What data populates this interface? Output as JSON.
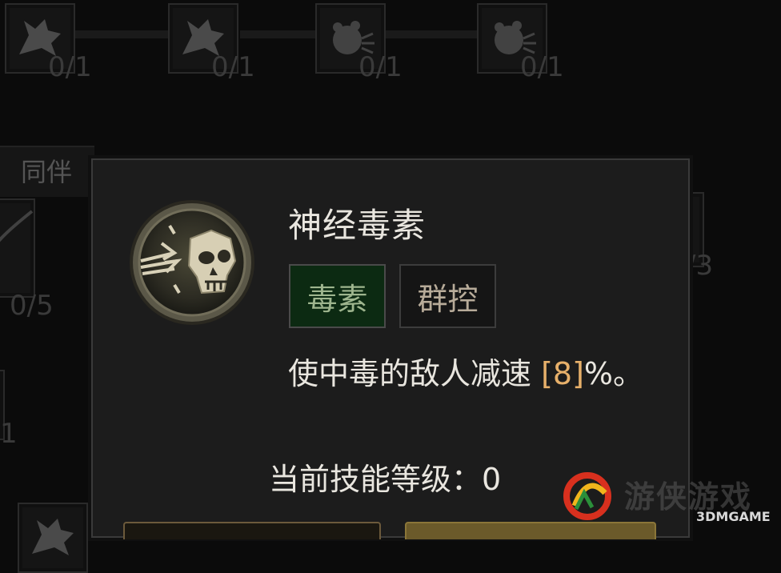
{
  "background": {
    "companion_tab": "同伴",
    "node_counts": [
      "0/1",
      "0/1",
      "0/1",
      "0/1",
      "0/5",
      "/3",
      "1"
    ],
    "node_icons": [
      "wolf-head-icon",
      "wolf-head-icon",
      "bear-roar-icon",
      "bear-roar-icon",
      "thorn-vine-icon",
      "partial-node-icon",
      "wolf-head-icon"
    ]
  },
  "tooltip": {
    "icon": "poison-skull-icon",
    "title": "神经毒素",
    "tags": [
      "毒素",
      "群控"
    ],
    "description_prefix": "使中毒的敌人减速 ",
    "description_value": "[8]",
    "description_suffix": "%。",
    "level_label": "当前技能等级：0"
  },
  "watermark": {
    "site": "游侠游戏",
    "brand": "3DMGAME"
  },
  "colors": {
    "toxin_tag_bg": "#0c2a12",
    "value_highlight": "#e7b06a",
    "panel_bg": "#1c1c1c"
  }
}
